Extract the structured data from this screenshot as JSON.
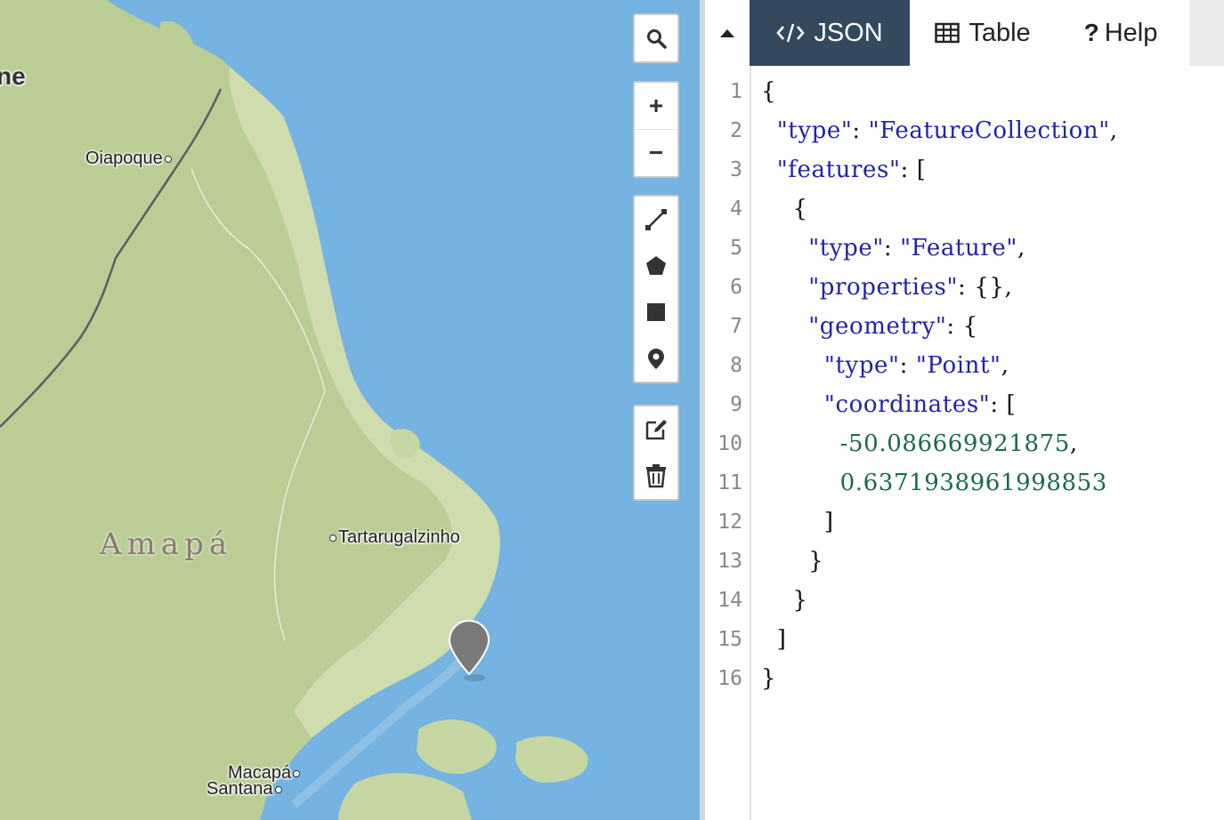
{
  "map": {
    "places": [
      {
        "id": "partial-top",
        "label": "ne"
      },
      {
        "id": "oiapoque",
        "label": "Oiapoque"
      },
      {
        "id": "tartarugalzinho",
        "label": "Tartarugalzinho"
      },
      {
        "id": "macapa",
        "label": "Macapá"
      },
      {
        "id": "santana",
        "label": "Santana"
      }
    ],
    "region_label": "Amapá",
    "controls": {
      "search": "search-icon",
      "zoom_in": "+",
      "zoom_out": "−",
      "draw_tools": [
        "line-icon",
        "polygon-icon",
        "rectangle-icon",
        "marker-icon"
      ],
      "edit_tools": [
        "edit-icon",
        "trash-icon"
      ]
    },
    "colors": {
      "water": "#74b3e2",
      "land": "#b8cc92",
      "marker": "#7a7a7a"
    }
  },
  "panel": {
    "tabs": [
      {
        "id": "json",
        "label": "JSON",
        "icon": "code-icon",
        "active": true
      },
      {
        "id": "table",
        "label": "Table",
        "icon": "table-icon",
        "active": false
      },
      {
        "id": "help",
        "label": "Help",
        "icon": "question-icon",
        "active": false
      }
    ],
    "collapse_icon": "triangle-up-icon",
    "accent": "#34495e",
    "json_lines": [
      "{",
      "  \"type\": \"FeatureCollection\",",
      "  \"features\": [",
      "    {",
      "      \"type\": \"Feature\",",
      "      \"properties\": {},",
      "      \"geometry\": {",
      "        \"type\": \"Point\",",
      "        \"coordinates\": [",
      "          -50.086669921875,",
      "          0.6371938961998853",
      "        ]",
      "      }",
      "    }",
      "  ]",
      "}"
    ]
  }
}
